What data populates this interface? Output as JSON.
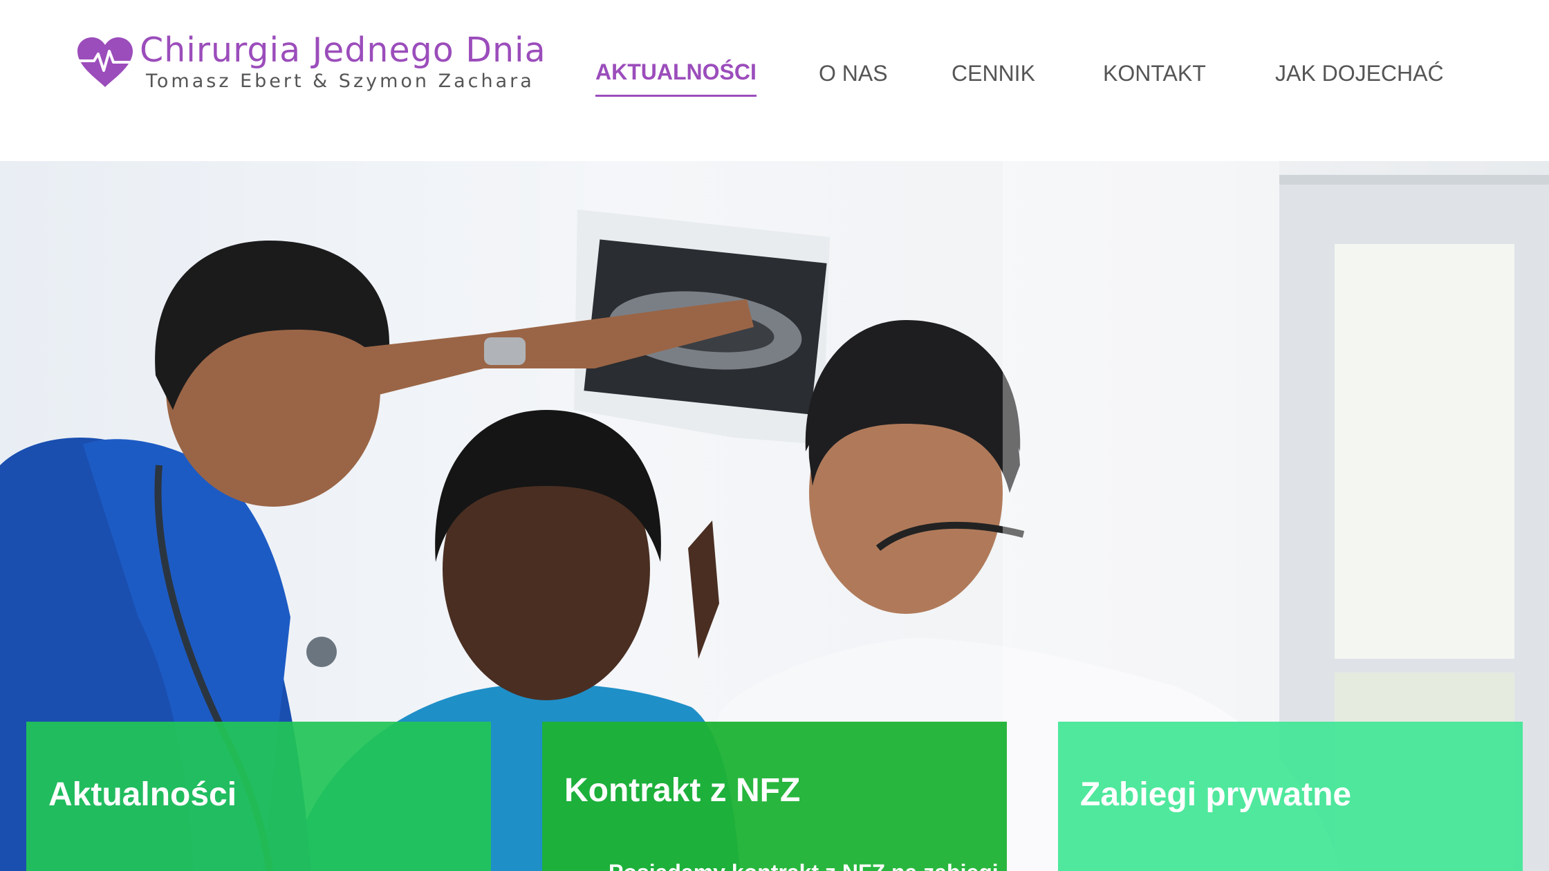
{
  "brand": {
    "name": "Chirurgia Jednego Dnia",
    "tagline": "Tomasz Ebert & Szymon Zachara",
    "logo_icon": "heart-pulse-icon",
    "accent_color": "#9b4dbb"
  },
  "nav": {
    "items": [
      {
        "label": "AKTUALNOŚCI",
        "active": true
      },
      {
        "label": "O NAS",
        "active": false
      },
      {
        "label": "CENNIK",
        "active": false
      },
      {
        "label": "KONTAKT",
        "active": false
      },
      {
        "label": "JAK DOJECHAĆ",
        "active": false
      }
    ]
  },
  "hero": {
    "image_alt": "Lekarze oglądający zdjęcie rentgenowskie"
  },
  "cards": [
    {
      "title": "Aktualności",
      "color": "#22c557"
    },
    {
      "title": "Kontrakt z NFZ",
      "text": "Posiadamy kontrakt z NFZ na zabiegi",
      "color": "#1eb234"
    },
    {
      "title": "Zabiegi prywatne",
      "color": "#42e696"
    }
  ]
}
